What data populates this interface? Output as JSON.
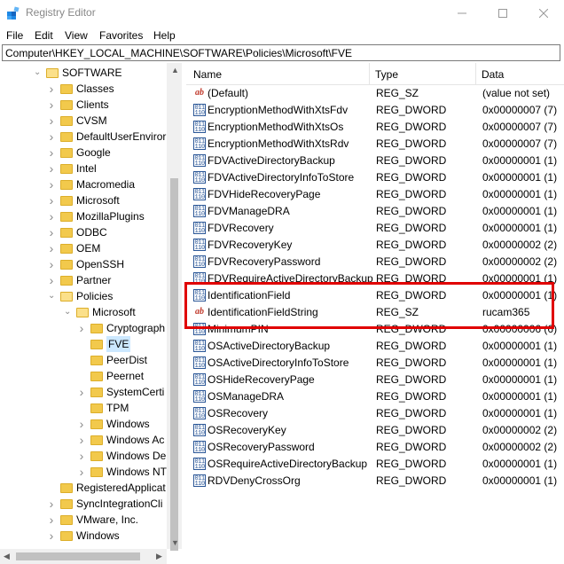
{
  "window": {
    "title": "Registry Editor"
  },
  "menu": [
    "File",
    "Edit",
    "View",
    "Favorites",
    "Help"
  ],
  "address": "Computer\\HKEY_LOCAL_MACHINE\\SOFTWARE\\Policies\\Microsoft\\FVE",
  "tree": [
    {
      "label": "SOFTWARE",
      "level": 0,
      "expanded": true
    },
    {
      "label": "Classes",
      "level": 1
    },
    {
      "label": "Clients",
      "level": 1
    },
    {
      "label": "CVSM",
      "level": 1
    },
    {
      "label": "DefaultUserEnviror",
      "level": 1
    },
    {
      "label": "Google",
      "level": 1
    },
    {
      "label": "Intel",
      "level": 1
    },
    {
      "label": "Macromedia",
      "level": 1
    },
    {
      "label": "Microsoft",
      "level": 1
    },
    {
      "label": "MozillaPlugins",
      "level": 1
    },
    {
      "label": "ODBC",
      "level": 1
    },
    {
      "label": "OEM",
      "level": 1
    },
    {
      "label": "OpenSSH",
      "level": 1
    },
    {
      "label": "Partner",
      "level": 1
    },
    {
      "label": "Policies",
      "level": 1,
      "expanded": true
    },
    {
      "label": "Microsoft",
      "level": 2,
      "expanded": true
    },
    {
      "label": "Cryptograph",
      "level": 3
    },
    {
      "label": "FVE",
      "level": 3,
      "selected": true,
      "nochevron": true
    },
    {
      "label": "PeerDist",
      "level": 3,
      "nochevron": true
    },
    {
      "label": "Peernet",
      "level": 3,
      "nochevron": true
    },
    {
      "label": "SystemCerti",
      "level": 3
    },
    {
      "label": "TPM",
      "level": 3,
      "nochevron": true
    },
    {
      "label": "Windows",
      "level": 3
    },
    {
      "label": "Windows Ac",
      "level": 3
    },
    {
      "label": "Windows De",
      "level": 3
    },
    {
      "label": "Windows NT",
      "level": 3
    },
    {
      "label": "RegisteredApplicat",
      "level": 1,
      "nochevron": true
    },
    {
      "label": "SyncIntegrationCli",
      "level": 1
    },
    {
      "label": "VMware, Inc.",
      "level": 1
    },
    {
      "label": "Windows",
      "level": 1
    }
  ],
  "columns": {
    "name": "Name",
    "type": "Type",
    "data": "Data"
  },
  "values": [
    {
      "name": "(Default)",
      "type": "REG_SZ",
      "data": "(value not set)",
      "kind": "sz"
    },
    {
      "name": "EncryptionMethodWithXtsFdv",
      "type": "REG_DWORD",
      "data": "0x00000007 (7)",
      "kind": "dw"
    },
    {
      "name": "EncryptionMethodWithXtsOs",
      "type": "REG_DWORD",
      "data": "0x00000007 (7)",
      "kind": "dw"
    },
    {
      "name": "EncryptionMethodWithXtsRdv",
      "type": "REG_DWORD",
      "data": "0x00000007 (7)",
      "kind": "dw"
    },
    {
      "name": "FDVActiveDirectoryBackup",
      "type": "REG_DWORD",
      "data": "0x00000001 (1)",
      "kind": "dw"
    },
    {
      "name": "FDVActiveDirectoryInfoToStore",
      "type": "REG_DWORD",
      "data": "0x00000001 (1)",
      "kind": "dw"
    },
    {
      "name": "FDVHideRecoveryPage",
      "type": "REG_DWORD",
      "data": "0x00000001 (1)",
      "kind": "dw"
    },
    {
      "name": "FDVManageDRA",
      "type": "REG_DWORD",
      "data": "0x00000001 (1)",
      "kind": "dw"
    },
    {
      "name": "FDVRecovery",
      "type": "REG_DWORD",
      "data": "0x00000001 (1)",
      "kind": "dw"
    },
    {
      "name": "FDVRecoveryKey",
      "type": "REG_DWORD",
      "data": "0x00000002 (2)",
      "kind": "dw"
    },
    {
      "name": "FDVRecoveryPassword",
      "type": "REG_DWORD",
      "data": "0x00000002 (2)",
      "kind": "dw"
    },
    {
      "name": "FDVRequireActiveDirectoryBackup",
      "type": "REG_DWORD",
      "data": "0x00000001 (1)",
      "kind": "dw"
    },
    {
      "name": "IdentificationField",
      "type": "REG_DWORD",
      "data": "0x00000001 (1)",
      "kind": "dw"
    },
    {
      "name": "IdentificationFieldString",
      "type": "REG_SZ",
      "data": "rucam365",
      "kind": "sz"
    },
    {
      "name": "MinimumPIN",
      "type": "REG_DWORD",
      "data": "0x00000006 (6)",
      "kind": "dw"
    },
    {
      "name": "OSActiveDirectoryBackup",
      "type": "REG_DWORD",
      "data": "0x00000001 (1)",
      "kind": "dw"
    },
    {
      "name": "OSActiveDirectoryInfoToStore",
      "type": "REG_DWORD",
      "data": "0x00000001 (1)",
      "kind": "dw"
    },
    {
      "name": "OSHideRecoveryPage",
      "type": "REG_DWORD",
      "data": "0x00000001 (1)",
      "kind": "dw"
    },
    {
      "name": "OSManageDRA",
      "type": "REG_DWORD",
      "data": "0x00000001 (1)",
      "kind": "dw"
    },
    {
      "name": "OSRecovery",
      "type": "REG_DWORD",
      "data": "0x00000001 (1)",
      "kind": "dw"
    },
    {
      "name": "OSRecoveryKey",
      "type": "REG_DWORD",
      "data": "0x00000002 (2)",
      "kind": "dw"
    },
    {
      "name": "OSRecoveryPassword",
      "type": "REG_DWORD",
      "data": "0x00000002 (2)",
      "kind": "dw"
    },
    {
      "name": "OSRequireActiveDirectoryBackup",
      "type": "REG_DWORD",
      "data": "0x00000001 (1)",
      "kind": "dw"
    },
    {
      "name": "RDVDenyCrossOrg",
      "type": "REG_DWORD",
      "data": "0x00000001 (1)",
      "kind": "dw"
    }
  ],
  "icons": {
    "string": "ab",
    "dword": "011 110"
  },
  "colors": {
    "highlight_border": "#e00000",
    "selection": "#cce8ff",
    "folder": "#f2c94c"
  }
}
